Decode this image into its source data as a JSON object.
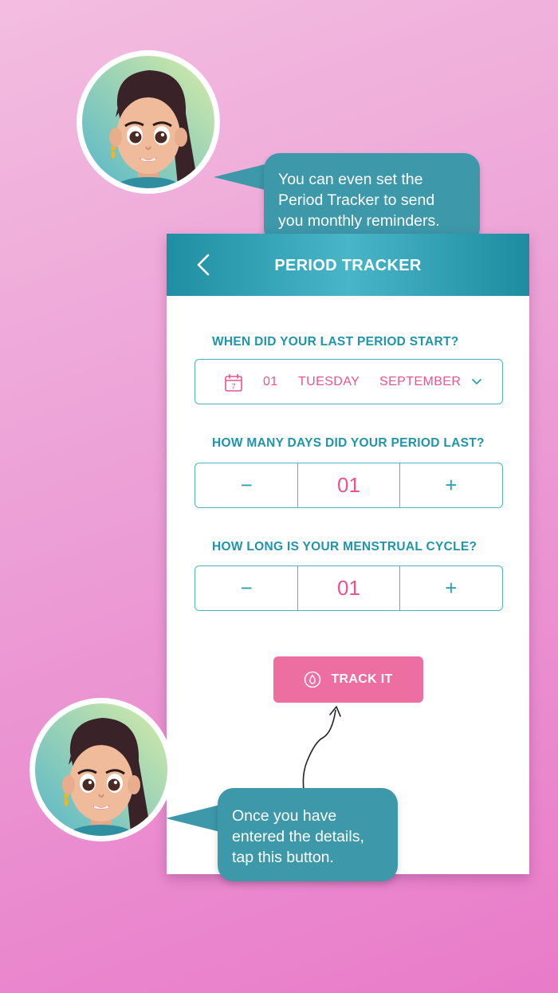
{
  "tips": {
    "top": {
      "lines": [
        "You can even set the",
        "Period Tracker to send",
        "you monthly reminders."
      ]
    },
    "bottom": {
      "lines": [
        "Once you have",
        "entered the details,",
        "tap this button."
      ]
    }
  },
  "app": {
    "title": "PERIOD TRACKER",
    "back_icon": "chevron-left-icon",
    "last_period": {
      "question": "WHEN DID YOUR LAST PERIOD START?",
      "day": "01",
      "weekday": "TUESDAY",
      "month": "SEPTEMBER",
      "calendar_day": "7"
    },
    "period_length": {
      "question": "HOW MANY DAYS DID YOUR PERIOD LAST?",
      "minus": "−",
      "value": "01",
      "plus": "+"
    },
    "cycle_length": {
      "question": "HOW LONG IS YOUR MENSTRUAL CYCLE?",
      "minus": "−",
      "value": "01",
      "plus": "+"
    },
    "track_button": {
      "label": "TRACK IT",
      "icon": "drop-icon"
    }
  },
  "colors": {
    "teal": "#1f95a8",
    "pink": "#e8548f",
    "button_pink": "#ed6fa2",
    "bubble_teal": "#3d98a9"
  }
}
